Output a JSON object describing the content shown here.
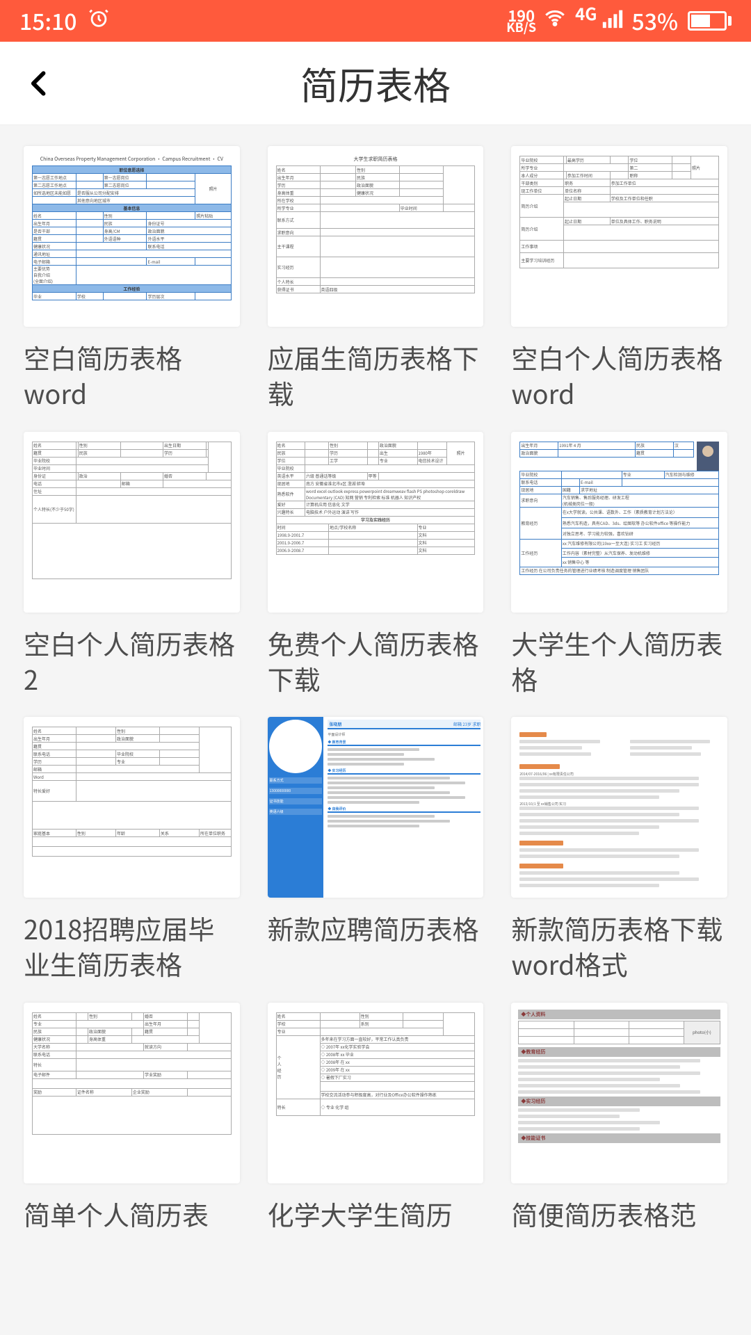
{
  "status": {
    "time": "15:10",
    "alarm_icon": "alarm-icon",
    "speed_top": "190",
    "speed_bot": "KB/S",
    "network_label": "4G",
    "battery_pct": "53%"
  },
  "header": {
    "title": "简历表格"
  },
  "items": [
    {
      "title": "空白简历表格word"
    },
    {
      "title": "应届生简历表格下载"
    },
    {
      "title": "空白个人简历表格word"
    },
    {
      "title": "空白个人简历表格2"
    },
    {
      "title": "免费个人简历表格下载"
    },
    {
      "title": "大学生个人简历表格"
    },
    {
      "title": "2018招聘应届毕业生简历表格"
    },
    {
      "title": "新款应聘简历表格"
    },
    {
      "title": "新款简历表格下载word格式"
    },
    {
      "title": "简单个人简历表"
    },
    {
      "title": "化学大学生简历"
    },
    {
      "title": "简便简历表格范"
    }
  ]
}
